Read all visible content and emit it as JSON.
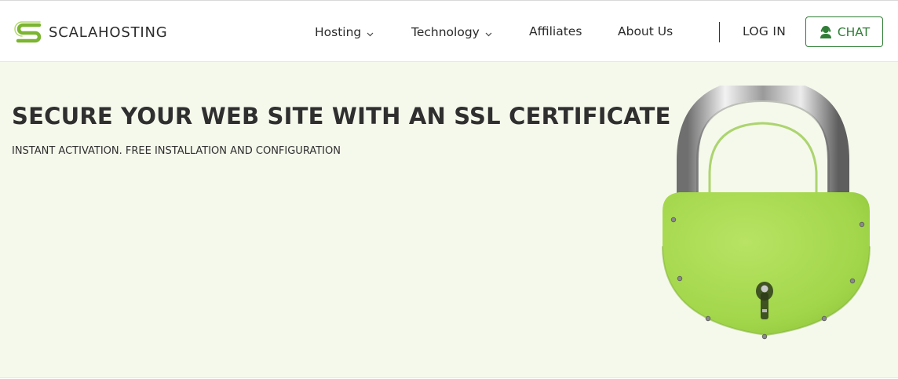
{
  "brand": {
    "name": "SCALAHOSTING",
    "color": "#7bb531"
  },
  "nav": {
    "items": [
      {
        "label": "Hosting",
        "has_dropdown": true
      },
      {
        "label": "Technology",
        "has_dropdown": true
      },
      {
        "label": "Affiliates",
        "has_dropdown": false
      },
      {
        "label": "About Us",
        "has_dropdown": false
      }
    ],
    "login_label": "LOG IN",
    "chat_label": "CHAT",
    "chat_color": "#2f7d36"
  },
  "hero": {
    "title": "SECURE YOUR WEB SITE WITH AN SSL CERTIFICATE",
    "subtitle": "INSTANT ACTIVATION. FREE INSTALLATION AND CONFIGURATION",
    "background": "#f5f9ec",
    "image_icon": "padlock-icon",
    "lock_color": "#a6d94a"
  }
}
